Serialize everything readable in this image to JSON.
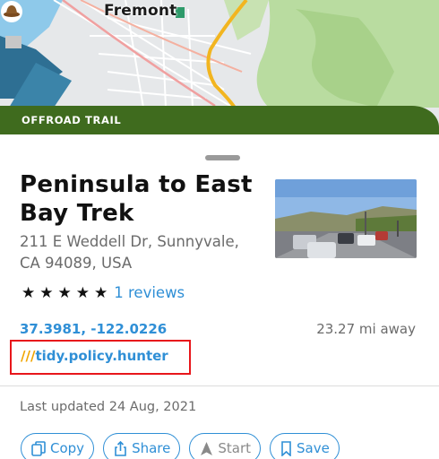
{
  "map": {
    "city_label": "Fremont",
    "category_banner": "OFFROAD TRAIL"
  },
  "place": {
    "title": "Peninsula to East Bay Trek",
    "address": "211 E Weddell Dr, Sunnyvale, CA 94089, USA",
    "rating_stars": 5,
    "reviews": "1 reviews",
    "coordinates": "37.3981, -122.0226",
    "distance": "23.27 mi away",
    "what3words_prefix": "///",
    "what3words": "tidy.policy.hunter",
    "last_updated": "Last updated 24 Aug, 2021"
  },
  "actions": {
    "copy": "Copy",
    "share": "Share",
    "start": "Start",
    "save": "Save"
  },
  "colors": {
    "accent_blue": "#2f8fd6",
    "trail_green": "#3f6b1e",
    "highlight_red": "#e8161b",
    "w3w_orange": "#f0a500"
  },
  "icons": [
    "location-pin-icon",
    "star-icon",
    "copy-icon",
    "share-icon",
    "navigate-arrow-icon",
    "bookmark-icon"
  ]
}
